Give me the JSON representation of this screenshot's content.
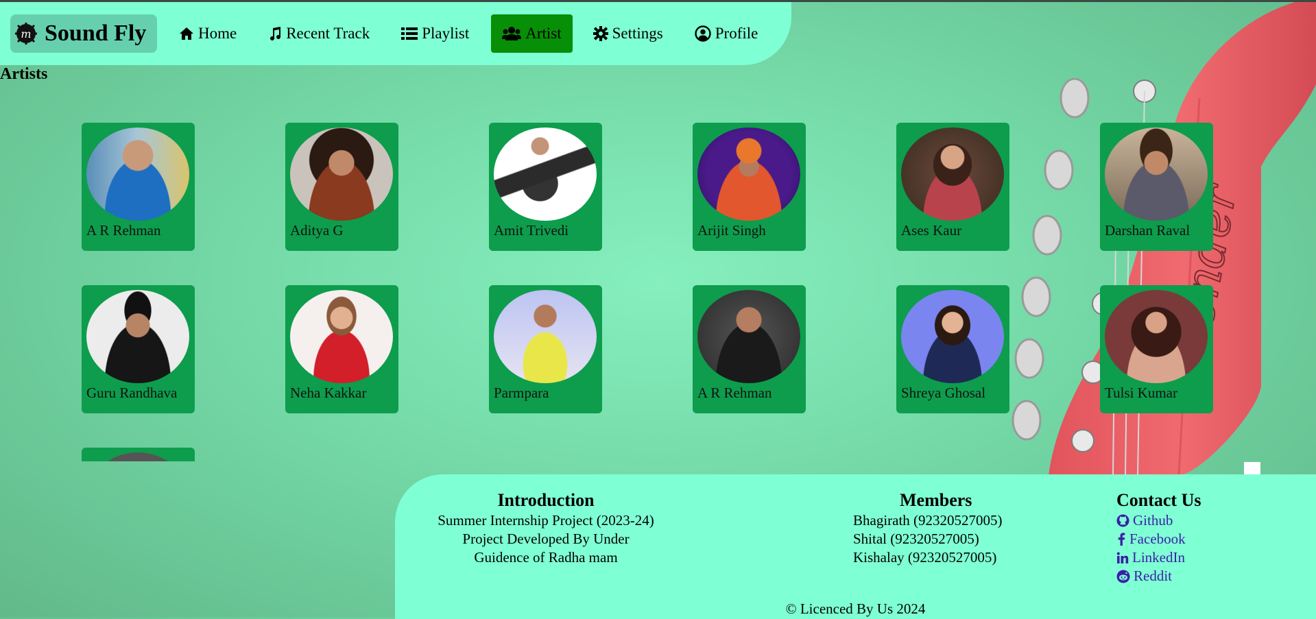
{
  "app": {
    "brand": "Sound Fly",
    "accent": "#078f07",
    "nav_bg": "#7fffd4",
    "card_bg": "#0d9d4d"
  },
  "nav": {
    "items": [
      {
        "label": "Home",
        "icon": "home-icon"
      },
      {
        "label": "Recent Track",
        "icon": "music-note-icon"
      },
      {
        "label": "Playlist",
        "icon": "list-icon"
      },
      {
        "label": "Artist",
        "icon": "users-icon",
        "active": true
      },
      {
        "label": "Settings",
        "icon": "gear-icon"
      },
      {
        "label": "Profile",
        "icon": "user-circle-icon"
      }
    ]
  },
  "page": {
    "title": "Artists"
  },
  "artists": [
    {
      "name": "A R Rehman"
    },
    {
      "name": "Aditya G"
    },
    {
      "name": "Amit Trivedi"
    },
    {
      "name": "Arijit Singh"
    },
    {
      "name": "Ases Kaur"
    },
    {
      "name": "Darshan Raval"
    },
    {
      "name": "Guru Randhava"
    },
    {
      "name": "Neha Kakkar"
    },
    {
      "name": "Parmpara"
    },
    {
      "name": "A R Rehman"
    },
    {
      "name": "Shreya Ghosal"
    },
    {
      "name": "Tulsi Kumar"
    }
  ],
  "footer": {
    "intro": {
      "title": "Introduction",
      "lines": [
        "Summer Internship Project (2023-24)",
        "Project Developed By Under",
        "Guidence of Radha mam"
      ]
    },
    "members": {
      "title": "Members",
      "lines": [
        "Bhagirath (92320527005)",
        "Shital (92320527005)",
        "Kishalay (92320527005)"
      ]
    },
    "contact": {
      "title": "Contact Us",
      "links": [
        {
          "label": "Github",
          "icon": "github-icon"
        },
        {
          "label": "Facebook",
          "icon": "facebook-icon"
        },
        {
          "label": "LinkedIn",
          "icon": "linkedin-icon"
        },
        {
          "label": "Reddit",
          "icon": "reddit-icon"
        }
      ]
    },
    "copyright": "© Licenced By Us 2024"
  }
}
